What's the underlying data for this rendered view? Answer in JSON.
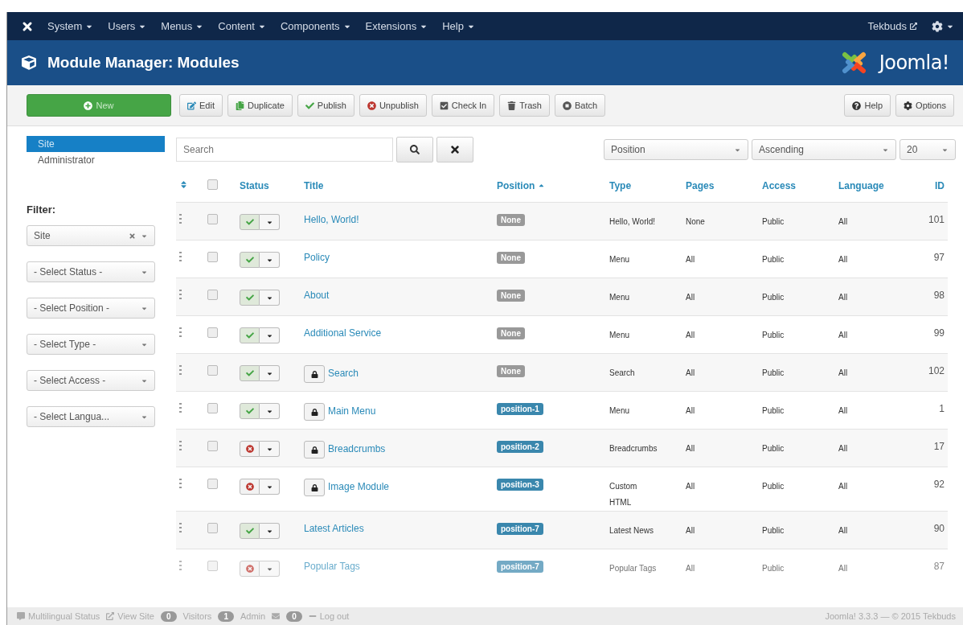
{
  "nav": {
    "menus": [
      "System",
      "Users",
      "Menus",
      "Content",
      "Components",
      "Extensions",
      "Help"
    ],
    "user": "Tekbuds"
  },
  "header": {
    "title": "Module Manager: Modules",
    "brand": "Joomla!"
  },
  "toolbar": {
    "buttons": [
      {
        "label": "New",
        "kind": "primary"
      },
      {
        "label": "Edit",
        "kind": "default"
      },
      {
        "label": "Duplicate",
        "kind": "default"
      },
      {
        "label": "Publish",
        "kind": "default"
      },
      {
        "label": "Unpublish",
        "kind": "default"
      },
      {
        "label": "Check In",
        "kind": "default"
      },
      {
        "label": "Trash",
        "kind": "default"
      },
      {
        "label": "Batch",
        "kind": "default"
      }
    ],
    "right_buttons": [
      "Help",
      "Options"
    ]
  },
  "sidebar": {
    "items": [
      {
        "label": "Site",
        "selected": true
      },
      {
        "label": "Administrator",
        "selected": false
      }
    ],
    "filter_label": "Filter:",
    "filters": [
      {
        "value": "Site",
        "clearable": true
      },
      {
        "value": "- Select Status -",
        "clearable": false
      },
      {
        "value": "- Select Position -",
        "clearable": false
      },
      {
        "value": "- Select Type -",
        "clearable": false
      },
      {
        "value": "- Select Access -",
        "clearable": false
      },
      {
        "value": "- Select Langua...",
        "clearable": false
      }
    ]
  },
  "search": {
    "placeholder": "Search"
  },
  "sort_selects": [
    "Position",
    "Ascending",
    "20"
  ],
  "table": {
    "select_all_checked": false,
    "columns": [
      {
        "label": "Status",
        "sorted": false
      },
      {
        "label": "Title",
        "sorted": false
      },
      {
        "label": "Position",
        "sorted": true
      },
      {
        "label": "Type",
        "sorted": false
      },
      {
        "label": "Pages",
        "sorted": false
      },
      {
        "label": "Access",
        "sorted": false
      },
      {
        "label": "Language",
        "sorted": false
      },
      {
        "label": "ID",
        "sorted": false
      }
    ],
    "rows": [
      {
        "title": "Hello, World!",
        "published": true,
        "locked": false,
        "checked": false,
        "faded": false,
        "position": "None",
        "assigned": false,
        "type": "Hello, World!",
        "pages": "None",
        "access": "Public",
        "language": "All",
        "id": "101"
      },
      {
        "title": "Policy",
        "published": true,
        "locked": false,
        "checked": false,
        "faded": false,
        "position": "None",
        "assigned": false,
        "type": "Menu",
        "pages": "All",
        "access": "Public",
        "language": "All",
        "id": "97"
      },
      {
        "title": "About",
        "published": true,
        "locked": false,
        "checked": false,
        "faded": false,
        "position": "None",
        "assigned": false,
        "type": "Menu",
        "pages": "All",
        "access": "Public",
        "language": "All",
        "id": "98"
      },
      {
        "title": "Additional Service",
        "published": true,
        "locked": false,
        "checked": false,
        "faded": false,
        "position": "None",
        "assigned": false,
        "type": "Menu",
        "pages": "All",
        "access": "Public",
        "language": "All",
        "id": "99"
      },
      {
        "title": "Search",
        "published": true,
        "locked": true,
        "checked": false,
        "faded": false,
        "position": "None",
        "assigned": false,
        "type": "Search",
        "pages": "All",
        "access": "Public",
        "language": "All",
        "id": "102"
      },
      {
        "title": "Main Menu",
        "published": true,
        "locked": true,
        "checked": false,
        "faded": false,
        "position": "position-1",
        "assigned": true,
        "type": "Menu",
        "pages": "All",
        "access": "Public",
        "language": "All",
        "id": "1"
      },
      {
        "title": "Breadcrumbs",
        "published": false,
        "locked": true,
        "checked": false,
        "faded": false,
        "position": "position-2",
        "assigned": true,
        "type": "Breadcrumbs",
        "pages": "All",
        "access": "Public",
        "language": "All",
        "id": "17"
      },
      {
        "title": "Image Module",
        "published": false,
        "locked": true,
        "checked": false,
        "faded": false,
        "position": "position-3",
        "assigned": true,
        "type": "Custom\nHTML",
        "pages": "All",
        "access": "Public",
        "language": "All",
        "id": "92"
      },
      {
        "title": "Latest Articles",
        "published": true,
        "locked": false,
        "checked": false,
        "faded": false,
        "position": "position-7",
        "assigned": true,
        "type": "Latest News",
        "pages": "All",
        "access": "Public",
        "language": "All",
        "id": "90"
      },
      {
        "title": "Popular Tags",
        "published": false,
        "locked": false,
        "checked": false,
        "faded": true,
        "position": "position-7",
        "assigned": true,
        "type": "Popular Tags",
        "pages": "All",
        "access": "Public",
        "language": "All",
        "id": "87"
      }
    ]
  },
  "footer": {
    "left": [
      {
        "kind": "link",
        "label": "Multilingual Status"
      },
      {
        "kind": "link",
        "label": "View Site"
      },
      {
        "kind": "count",
        "badge": "0",
        "label": "Visitors"
      },
      {
        "kind": "count",
        "badge": "1",
        "label": "Admin"
      },
      {
        "kind": "mail",
        "badge": "0"
      },
      {
        "kind": "link",
        "label": "Log out"
      }
    ],
    "right": "Joomla! 3.3.3 — © 2015 Tekbuds"
  }
}
